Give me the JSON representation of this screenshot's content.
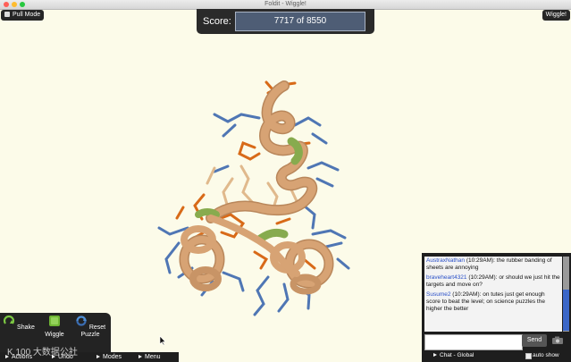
{
  "window": {
    "title": "Foldit - Wiggle!"
  },
  "topbar": {
    "pull_mode_label": "Pull Mode",
    "wiggle_label": "Wiggle!"
  },
  "score": {
    "label": "Score:",
    "value": "7717 of 8550"
  },
  "tools": [
    {
      "icon": "shake-icon",
      "label": "Shake"
    },
    {
      "icon": "wiggle-icon",
      "label": "Wiggle"
    },
    {
      "icon": "reset-puzzle-icon",
      "label": "Reset Puzzle"
    }
  ],
  "bottom_menu": [
    "Actions",
    "Undo",
    "Modes",
    "Menu"
  ],
  "watermark": "K 100 大数据公社",
  "chat": {
    "messages": [
      {
        "user": "AustraxNathan",
        "time": "(10:29AM):",
        "text": "the rubber banding of sheets are annoying"
      },
      {
        "user": "braveheart4321",
        "time": "(10:29AM):",
        "text": "or should we just hit the targets and move on?"
      },
      {
        "user": "Susume2",
        "time": "(10:29AM):",
        "text": "on tutes just get enough score to beat the level; on science puzzles the higher the better"
      }
    ],
    "input_placeholder": "",
    "send_label": "Send",
    "channel_label": "Chat - Global",
    "autoshow_label": "auto show"
  },
  "colors": {
    "background": "#fcfbe9",
    "backbone": "#d7a374",
    "backbone_dark": "#b9875b",
    "sheet": "#87ab4e",
    "hydrophobic": "#d86a18",
    "polar": "#4f76b4",
    "panel": "#232323",
    "link_user": "#2a50c8"
  }
}
